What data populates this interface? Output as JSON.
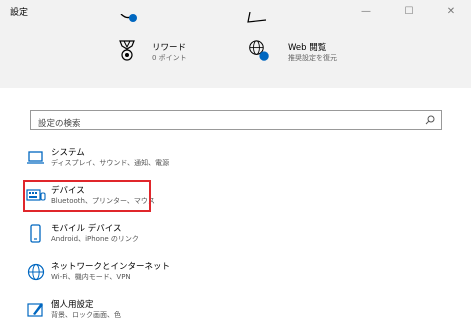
{
  "window": {
    "title": "設定",
    "minimize_glyph": "—",
    "maximize_glyph": "☐",
    "close_glyph": "✕"
  },
  "header": {
    "items": [
      {
        "title": "リワード",
        "subtitle": "0 ポイント",
        "icon": "medal-icon"
      },
      {
        "title": "Web 閲覧",
        "subtitle": "推奨設定を復元",
        "icon": "globe-icon"
      }
    ]
  },
  "search": {
    "placeholder": "設定の検索",
    "icon": "search-icon"
  },
  "categories": [
    {
      "title": "システム",
      "subtitle": "ディスプレイ、サウンド、通知、電源",
      "icon": "laptop-icon"
    },
    {
      "title": "デバイス",
      "subtitle": "Bluetooth、プリンター、マウス",
      "icon": "keyboard-icon"
    },
    {
      "title": "モバイル デバイス",
      "subtitle": "Android、iPhone のリンク",
      "icon": "phone-icon"
    },
    {
      "title": "ネットワークとインターネット",
      "subtitle": "Wi-Fi、機内モード、VPN",
      "icon": "globe-icon"
    },
    {
      "title": "個人用設定",
      "subtitle": "背景、ロック画面、色",
      "icon": "paint-icon"
    }
  ],
  "colors": {
    "accent": "#0067c0",
    "highlight": "#e0262b",
    "header_bg": "#f2f2f2"
  }
}
